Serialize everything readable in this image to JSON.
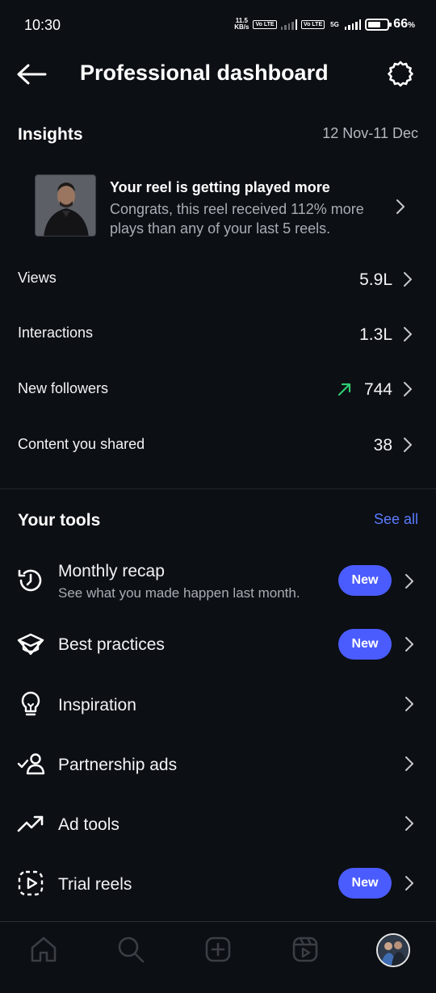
{
  "status_bar": {
    "time": "10:30",
    "net_speed_value": "11.5",
    "net_speed_unit": "KB/s",
    "sim1_tag": "Vo LTE",
    "sim2_tag": "Vo LTE",
    "network_type": "5G",
    "battery_percent": "66",
    "battery_unit": "%",
    "battery_level": 0.66
  },
  "header": {
    "title": "Professional dashboard",
    "back_icon": "back-arrow-icon",
    "settings_icon": "gear-icon"
  },
  "insights": {
    "title": "Insights",
    "date_range": "12 Nov-11 Dec",
    "reel_card": {
      "title": "Your reel is getting played more",
      "subtitle": "Congrats, this reel received 112% more plays than any of your last 5 reels."
    },
    "metrics": [
      {
        "label": "Views",
        "value": "5.9L"
      },
      {
        "label": "Interactions",
        "value": "1.3L"
      },
      {
        "label": "New followers",
        "value": "744",
        "trend": "up-trend-icon",
        "trend_color": "#2ecc71"
      },
      {
        "label": "Content you shared",
        "value": "38"
      }
    ]
  },
  "tools": {
    "title": "Your tools",
    "see_all": "See all",
    "items": [
      {
        "label": "Monthly recap",
        "subtitle": "See what you made happen last month.",
        "badge": "New",
        "icon": "history-clock-icon"
      },
      {
        "label": "Best practices",
        "badge": "New",
        "icon": "graduation-cap-icon"
      },
      {
        "label": "Inspiration",
        "icon": "lightbulb-icon"
      },
      {
        "label": "Partnership ads",
        "icon": "partnership-user-check-icon"
      },
      {
        "label": "Ad tools",
        "icon": "trending-up-icon"
      },
      {
        "label": "Trial reels",
        "badge": "New",
        "icon": "trial-reel-play-icon"
      }
    ]
  },
  "bottom_nav": {
    "items": [
      "home-icon",
      "search-icon",
      "create-plus-icon",
      "reels-icon",
      "profile-avatar"
    ]
  },
  "colors": {
    "background": "#0c0f14",
    "accent_link": "#5b7bff",
    "badge": "#4b5cff",
    "trend_up": "#2ecc71"
  }
}
